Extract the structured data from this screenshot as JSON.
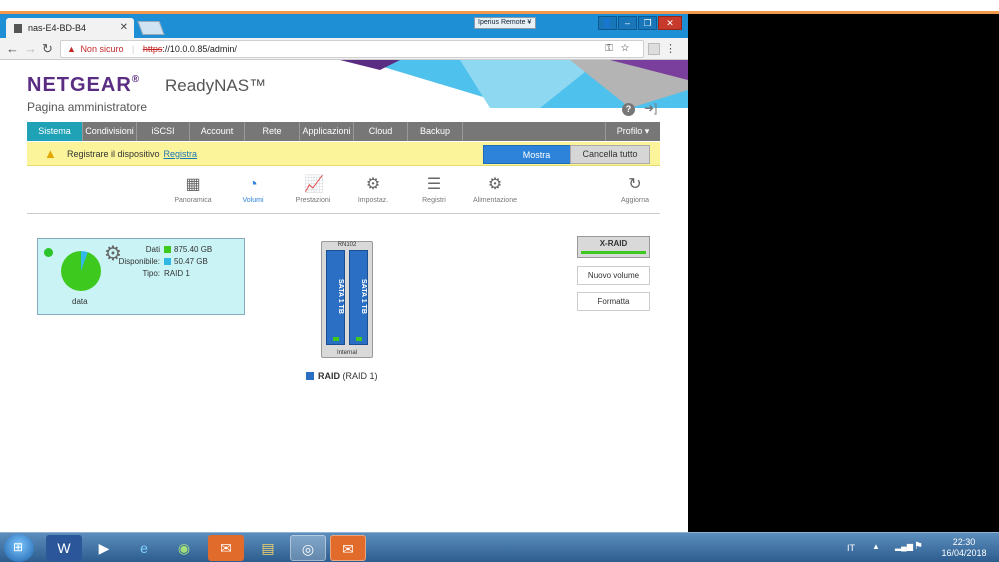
{
  "browser": {
    "tab_title": "nas-E4-BD-B4",
    "remote_label": "Iperius Remote",
    "security_label": "Non sicuro",
    "url_scheme": "https",
    "url_rest": "://10.0.0.85/admin/"
  },
  "header": {
    "brand": "NETGEAR",
    "brand_mark": "®",
    "product": "ReadyNAS™",
    "page_title": "Pagina amministratore"
  },
  "navbar": {
    "items": [
      {
        "label": "Sistema",
        "active": true
      },
      {
        "label": "Condivisioni"
      },
      {
        "label": "iSCSI"
      },
      {
        "label": "Account"
      },
      {
        "label": "Rete"
      },
      {
        "label": "Applicazioni"
      },
      {
        "label": "Cloud"
      },
      {
        "label": "Backup"
      }
    ],
    "profile": "Profilo ▾"
  },
  "notice": {
    "text": "Registrare il dispositivo",
    "link": "Registra",
    "show_button": "Mostra",
    "cancel_button": "Cancella tutto"
  },
  "subnav": {
    "items": [
      {
        "label": "Panoramica",
        "icon": "grid-icon"
      },
      {
        "label": "Volumi",
        "icon": "pie-chart-icon",
        "active": true
      },
      {
        "label": "Prestazioni",
        "icon": "line-chart-icon"
      },
      {
        "label": "Impostaz.",
        "icon": "gear-icon"
      },
      {
        "label": "Registri",
        "icon": "list-icon"
      },
      {
        "label": "Alimentazione",
        "icon": "power-settings-icon"
      },
      {
        "label": "Aggiorna",
        "icon": "refresh-icon"
      }
    ]
  },
  "volume": {
    "name": "data",
    "data_label": "Dati",
    "data_value": "875.40 GB",
    "free_label": "Disponibile",
    "free_value": "50.47 GB",
    "type_label": "Tipo:",
    "type_value": "RAID 1",
    "colors": {
      "used": "#3ec91f",
      "free": "#32b8e6"
    }
  },
  "nas": {
    "model": "RN102",
    "disk1": "SATA 1 TB",
    "disk2": "SATA 1 TB",
    "footer": "Internal",
    "raid_name": "RAID",
    "raid_type": "(RAID 1)"
  },
  "actions": {
    "xraid": "X-RAID",
    "new_volume": "Nuovo volume",
    "format": "Formatta"
  },
  "taskbar": {
    "lang": "IT",
    "time": "22:30",
    "date": "16/04/2018"
  }
}
